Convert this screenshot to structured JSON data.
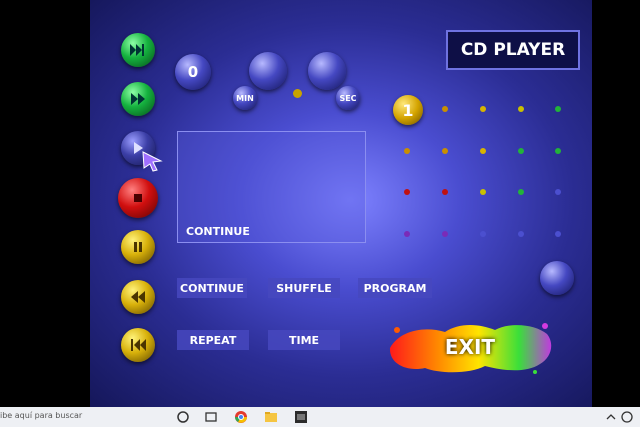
{
  "app": {
    "title": "CD PLAYER",
    "counter": {
      "track": "0",
      "min_label": "MIN",
      "sec_label": "SEC"
    },
    "display_text": "CONTINUE",
    "current_track": "1",
    "buttons": {
      "continue": "CONTINUE",
      "shuffle": "SHUFFLE",
      "program": "PROGRAM",
      "repeat": "REPEAT",
      "time": "TIME",
      "exit": "EXIT"
    },
    "transport": [
      "next-track",
      "fast-forward",
      "play",
      "stop",
      "pause",
      "rewind",
      "previous-track"
    ]
  },
  "taskbar": {
    "search_placeholder": "ibe aquí para buscar"
  },
  "colors": {
    "green": "#15b23f",
    "red": "#d10f0f",
    "yellow": "#d8b10a",
    "panel": "#2b2d94"
  }
}
